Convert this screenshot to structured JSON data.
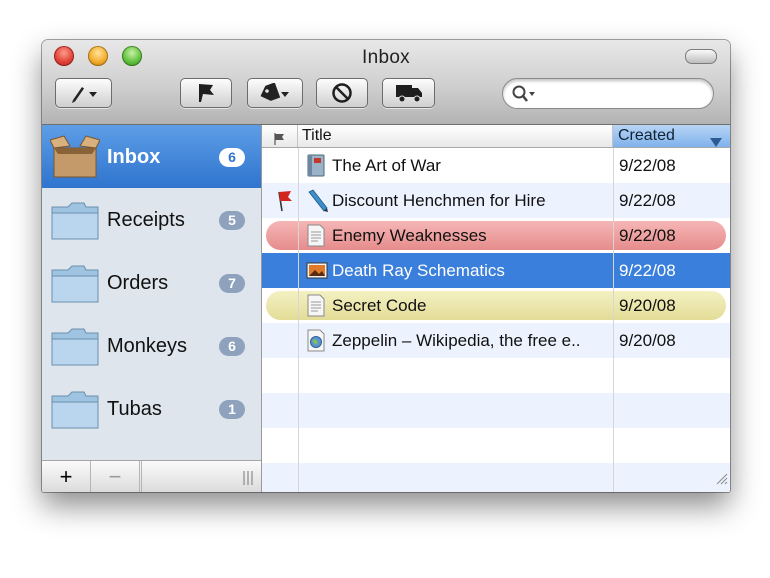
{
  "window": {
    "title": "Inbox"
  },
  "toolbar": {
    "buttons": [
      {
        "name": "pen-menu",
        "icon": "pen-icon"
      },
      {
        "name": "flag",
        "icon": "flag-icon"
      },
      {
        "name": "label-menu",
        "icon": "tag-icon"
      },
      {
        "name": "block",
        "icon": "no-entry-icon"
      },
      {
        "name": "move",
        "icon": "truck-icon"
      }
    ],
    "search": {
      "value": "",
      "placeholder": ""
    }
  },
  "sidebar": {
    "items": [
      {
        "label": "Inbox",
        "count": "6",
        "icon": "inbox-box-icon",
        "selected": true
      },
      {
        "label": "Receipts",
        "count": "5",
        "icon": "folder-icon"
      },
      {
        "label": "Orders",
        "count": "7",
        "icon": "folder-icon"
      },
      {
        "label": "Monkeys",
        "count": "6",
        "icon": "folder-icon"
      },
      {
        "label": "Tubas",
        "count": "1",
        "icon": "folder-icon"
      }
    ],
    "footer": {
      "add": "+",
      "remove": "−"
    }
  },
  "table": {
    "columns": {
      "title": "Title",
      "created": "Created"
    },
    "rows": [
      {
        "title": "The Art of War",
        "created": "9/22/08",
        "icon": "book-icon"
      },
      {
        "title": "Discount Henchmen for Hire",
        "created": "9/22/08",
        "icon": "pencil-icon",
        "flagged": true
      },
      {
        "title": "Enemy Weaknesses",
        "created": "9/22/08",
        "icon": "document-icon",
        "label": "red"
      },
      {
        "title": "Death Ray Schematics",
        "created": "9/22/08",
        "icon": "image-icon",
        "selected": true
      },
      {
        "title": "Secret Code",
        "created": "9/20/08",
        "icon": "document-icon",
        "label": "yellow"
      },
      {
        "title": "Zeppelin – Wikipedia, the free e..",
        "created": "9/20/08",
        "icon": "web-archive-icon"
      }
    ]
  },
  "colors": {
    "selection": "#3a7fdb",
    "label_red": "#e68c8c",
    "label_yellow": "#e3dc96",
    "sidebar_bg": "#dfe5ec"
  }
}
